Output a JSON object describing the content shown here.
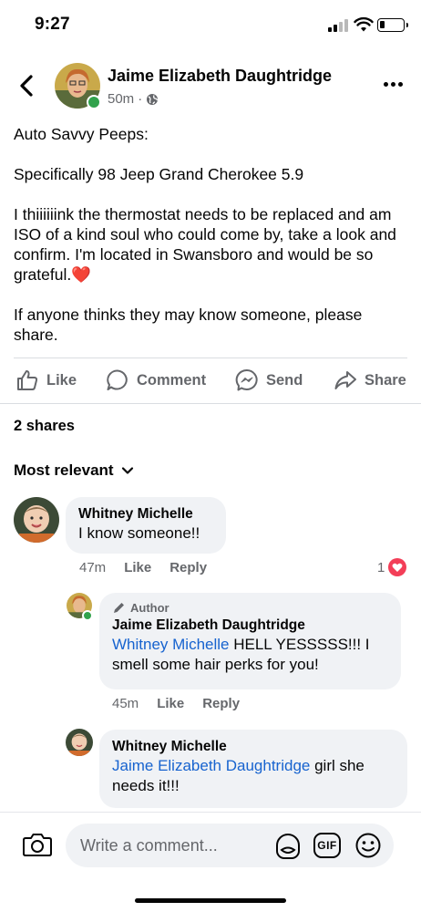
{
  "status_bar": {
    "time": "9:27",
    "battery_level": 0.2
  },
  "post": {
    "author": "Jaime Elizabeth Daughtridge",
    "timestamp": "50m",
    "separator": "·",
    "privacy_icon": "globe-icon",
    "paragraphs": [
      "Auto Savvy Peeps:",
      "Specifically 98 Jeep Grand Cherokee 5.9",
      "I thiiiiiink the thermostat needs to be replaced and am ISO of a kind soul who could come by, take a look and confirm. I'm located in Swansboro and would be so grateful.",
      "If anyone thinks they may know someone, please share."
    ],
    "heart_emoji": "❤️"
  },
  "actions": {
    "like": "Like",
    "comment": "Comment",
    "send": "Send",
    "share": "Share"
  },
  "shares_text": "2 shares",
  "sort_label": "Most relevant",
  "comments": [
    {
      "name": "Whitney Michelle",
      "text": "I know someone!!",
      "time": "47m",
      "like": "Like",
      "reply": "Reply",
      "reaction_count": "1"
    },
    {
      "author_tag": "Author",
      "name": "Jaime Elizabeth Daughtridge",
      "mention": "Whitney Michelle",
      "text": " HELL YESSSSS!!! I smell some hair perks for you!",
      "time": "45m",
      "like": "Like",
      "reply": "Reply"
    },
    {
      "name": "Whitney Michelle",
      "mention": "Jaime Elizabeth Daughtridge",
      "text": " girl she needs it!!!"
    }
  ],
  "composer": {
    "placeholder": "Write a comment...",
    "gif_label": "GIF"
  },
  "colors": {
    "accent_blue": "#1763cf",
    "online_green": "#31a24c",
    "heart_red": "#f33e58",
    "secondary_text": "#65676b",
    "bubble_bg": "#f0f2f5"
  }
}
